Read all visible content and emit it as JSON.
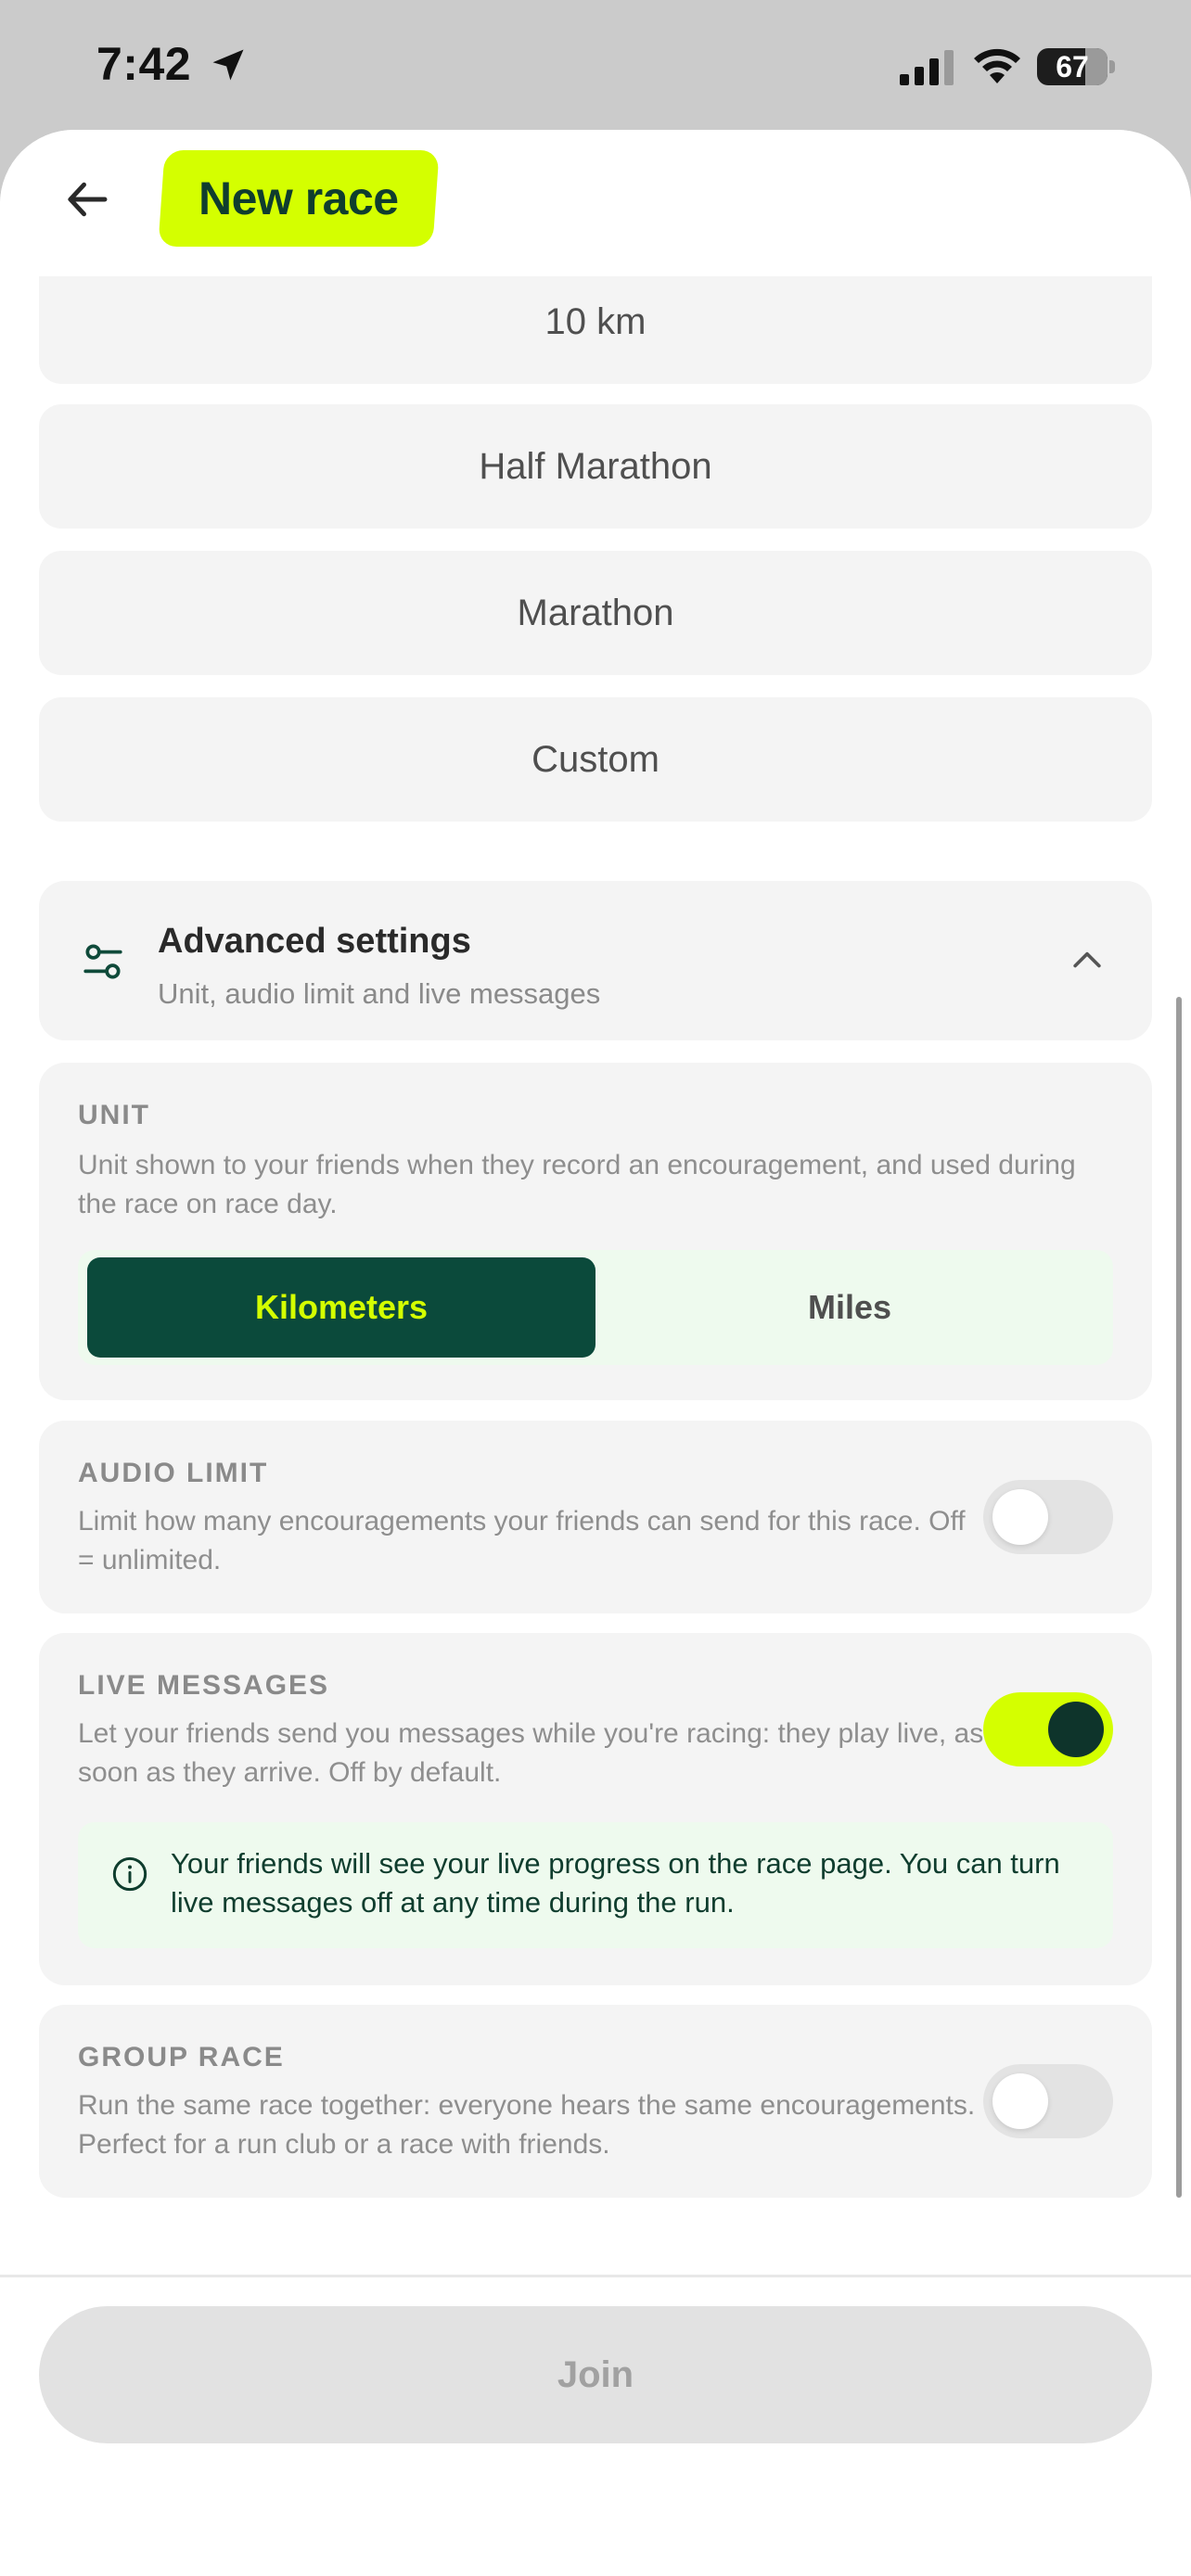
{
  "status_bar": {
    "time": "7:42",
    "battery": "67"
  },
  "header": {
    "title": "New race"
  },
  "distance_options": [
    "10 km",
    "Half Marathon",
    "Marathon",
    "Custom"
  ],
  "advanced_settings": {
    "title": "Advanced settings",
    "subtitle": "Unit, audio limit and live messages",
    "expanded": true
  },
  "unit": {
    "label": "UNIT",
    "description": "Unit shown to your friends when they record an encouragement, and used during the race on race day.",
    "options": [
      "Kilometers",
      "Miles"
    ],
    "selected": "Kilometers"
  },
  "audio_limit": {
    "label": "AUDIO LIMIT",
    "description": "Limit how many encouragements your friends can send for this race. Off = unlimited.",
    "enabled": false
  },
  "live_messages": {
    "label": "LIVE MESSAGES",
    "description": "Let your friends send you messages while you're racing: they play live, as soon as they arrive. Off by default.",
    "enabled": true,
    "info": "Your friends will see your live progress on the race page. You can turn live messages off at any time during the run."
  },
  "group_race": {
    "label": "GROUP RACE",
    "description": "Run the same race together: everyone hears the same encouragements. Perfect for a run club or a race with friends.",
    "enabled": false
  },
  "footer": {
    "join_label": "Join"
  },
  "colors": {
    "accent": "#d4ff00",
    "dark_green": "#0b4a3b",
    "card_bg": "#f4f4f4",
    "soft_green": "#eefaee"
  }
}
